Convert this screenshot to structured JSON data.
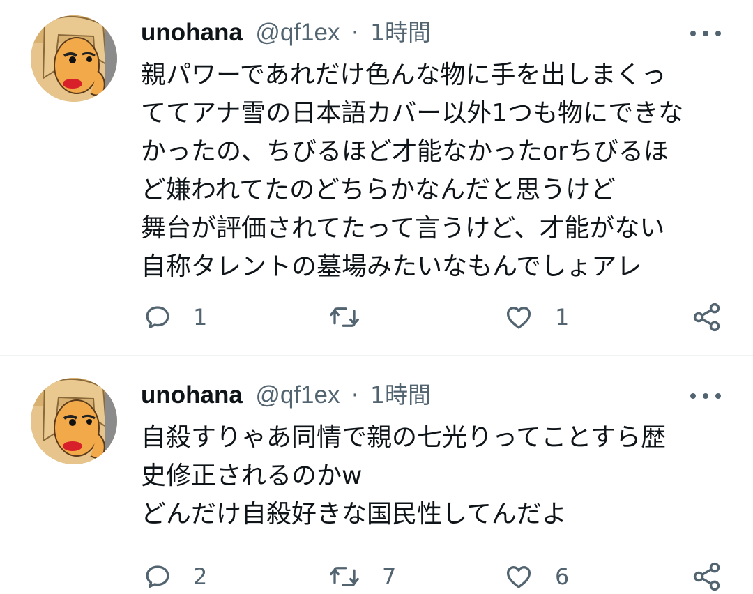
{
  "tweets": [
    {
      "author": {
        "name": "unohana",
        "handle": "@qf1ex"
      },
      "separator": "·",
      "time": "1時間",
      "text_lines": [
        "親パワーであれだけ色んな物に手を出しまくっ",
        "ててアナ雪の日本語カバー以外1つも物にできな",
        "かったの、ちびるほど才能なかったorちびるほ",
        "ど嫌われてたのどちらかなんだと思うけど",
        "舞台が評価されてたって言うけど、才能がない",
        "自称タレントの墓場みたいなもんでしょアレ"
      ],
      "stats": {
        "replies": "1",
        "retweets": "",
        "likes": "1"
      }
    },
    {
      "author": {
        "name": "unohana",
        "handle": "@qf1ex"
      },
      "separator": "·",
      "time": "1時間",
      "text_lines": [
        "自殺すりゃあ同情で親の七光りってことすら歴",
        "史修正されるのかw",
        "どんだけ自殺好きな国民性してんだよ"
      ],
      "stats": {
        "replies": "2",
        "retweets": "7",
        "likes": "6"
      }
    }
  ],
  "icons": {
    "more": "more-horizontal-icon",
    "reply": "reply-bubble-icon",
    "retweet": "retweet-icon",
    "like": "heart-icon",
    "share": "share-icon"
  },
  "colors": {
    "text": "#0f1419",
    "secondary": "#536471",
    "divider": "#eff3f4"
  }
}
